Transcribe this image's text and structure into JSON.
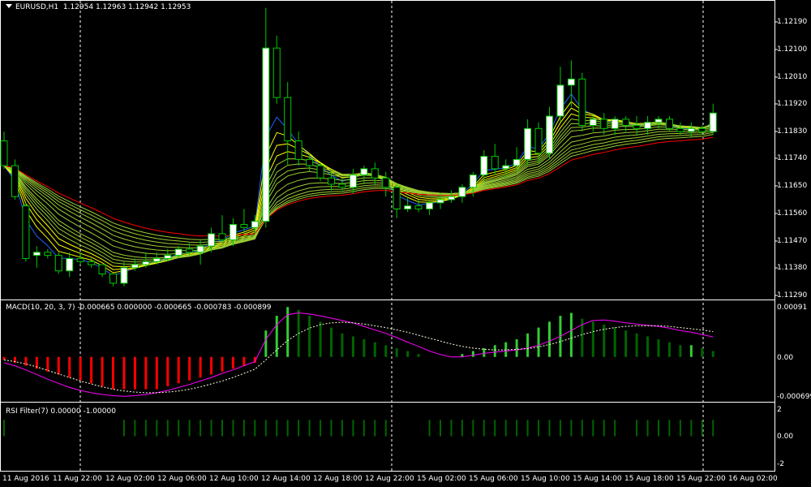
{
  "chart": {
    "symbol": "EURUSD,H1",
    "ohlc": [
      "1.12954",
      "1.12963",
      "1.12942",
      "1.12953"
    ],
    "price_axis": [
      "1.12190",
      "1.12100",
      "1.12010",
      "1.11920",
      "1.11830",
      "1.11740",
      "1.11650",
      "1.11560",
      "1.11470",
      "1.11380",
      "1.11290"
    ]
  },
  "macd": {
    "label": "MACD(10, 20, 3, 7) -0.000665 0.000000 -0.000665 -0.000783 -0.000899",
    "axis": [
      "0.00091",
      "0.00",
      "-0.000699"
    ]
  },
  "rsi": {
    "label": "RSI Filter(7) 0.00000 -1.00000",
    "axis": [
      "2",
      "0.00",
      "-2"
    ]
  },
  "time_axis": [
    "11 Aug 2016",
    "11 Aug 22:00",
    "12 Aug 02:00",
    "12 Aug 06:00",
    "12 Aug 10:00",
    "12 Aug 14:00",
    "12 Aug 18:00",
    "12 Aug 22:00",
    "15 Aug 02:00",
    "15 Aug 06:00",
    "15 Aug 10:00",
    "15 Aug 14:00",
    "15 Aug 18:00",
    "15 Aug 22:00",
    "16 Aug 02:00"
  ],
  "colors": {
    "bull": "#ffffff",
    "bear": "#000000",
    "wick": "#00c800",
    "ribbon_top": "#ffff00",
    "ribbon_low": "#ff0000",
    "ribbon_mid": "#9acd32",
    "blue_ema": "#1e5eff",
    "macd_pos_strong": "#32cd32",
    "macd_pos": "#006400",
    "macd_neg": "#ff0000",
    "macd_line": "#ff00ff",
    "signal_line": "#ffffe0",
    "rsi_bar": "#006400"
  },
  "chart_data": {
    "type": "candlestick",
    "timeframe": "H1",
    "candles": [
      [
        1.1178,
        1.1181,
        1.1169,
        1.117
      ],
      [
        1.117,
        1.1172,
        1.1159,
        1.116
      ],
      [
        1.1157,
        1.1158,
        1.1139,
        1.114
      ],
      [
        1.1141,
        1.1144,
        1.1137,
        1.1142
      ],
      [
        1.1142,
        1.1143,
        1.114,
        1.1141
      ],
      [
        1.1141,
        1.1142,
        1.1135,
        1.1136
      ],
      [
        1.1136,
        1.1142,
        1.1134,
        1.114
      ],
      [
        1.114,
        1.1142,
        1.1138,
        1.1139
      ],
      [
        1.1139,
        1.114,
        1.1137,
        1.1138
      ],
      [
        1.1138,
        1.1138,
        1.1134,
        1.1135
      ],
      [
        1.1135,
        1.1135,
        1.1131,
        1.1132
      ],
      [
        1.1132,
        1.1139,
        1.1131,
        1.1137
      ],
      [
        1.1137,
        1.114,
        1.1136,
        1.1138
      ],
      [
        1.1138,
        1.1142,
        1.1137,
        1.1139
      ],
      [
        1.1139,
        1.1142,
        1.1138,
        1.114
      ],
      [
        1.114,
        1.1143,
        1.1139,
        1.1141
      ],
      [
        1.1141,
        1.1144,
        1.114,
        1.1143
      ],
      [
        1.1143,
        1.1145,
        1.1141,
        1.1142
      ],
      [
        1.1142,
        1.1146,
        1.1138,
        1.1144
      ],
      [
        1.1144,
        1.115,
        1.1142,
        1.1148
      ],
      [
        1.1148,
        1.1154,
        1.1145,
        1.1146
      ],
      [
        1.1146,
        1.1153,
        1.1144,
        1.1151
      ],
      [
        1.1151,
        1.1156,
        1.1148,
        1.115
      ],
      [
        1.115,
        1.1154,
        1.1148,
        1.1152
      ],
      [
        1.1152,
        1.1221,
        1.115,
        1.1208
      ],
      [
        1.1208,
        1.1212,
        1.119,
        1.1192
      ],
      [
        1.1192,
        1.1197,
        1.117,
        1.1178
      ],
      [
        1.1178,
        1.1181,
        1.117,
        1.1172
      ],
      [
        1.1172,
        1.1174,
        1.1168,
        1.117
      ],
      [
        1.117,
        1.1171,
        1.1165,
        1.1166
      ],
      [
        1.1166,
        1.1168,
        1.1162,
        1.1164
      ],
      [
        1.1164,
        1.1166,
        1.1162,
        1.1163
      ],
      [
        1.1163,
        1.1169,
        1.1161,
        1.1167
      ],
      [
        1.1167,
        1.117,
        1.1164,
        1.1169
      ],
      [
        1.1169,
        1.1171,
        1.1164,
        1.1166
      ],
      [
        1.1166,
        1.1168,
        1.116,
        1.1163
      ],
      [
        1.1163,
        1.1164,
        1.1153,
        1.1156
      ],
      [
        1.1156,
        1.116,
        1.1155,
        1.1157
      ],
      [
        1.1157,
        1.1159,
        1.1155,
        1.1156
      ],
      [
        1.1156,
        1.1159,
        1.1154,
        1.1158
      ],
      [
        1.1158,
        1.1161,
        1.1156,
        1.1159
      ],
      [
        1.1159,
        1.1162,
        1.1158,
        1.116
      ],
      [
        1.116,
        1.1164,
        1.1158,
        1.1163
      ],
      [
        1.1163,
        1.1168,
        1.116,
        1.1167
      ],
      [
        1.1167,
        1.1175,
        1.1165,
        1.1173
      ],
      [
        1.1173,
        1.1177,
        1.1167,
        1.1169
      ],
      [
        1.1169,
        1.1172,
        1.1166,
        1.117
      ],
      [
        1.117,
        1.1176,
        1.1168,
        1.1172
      ],
      [
        1.1172,
        1.1185,
        1.117,
        1.1182
      ],
      [
        1.1182,
        1.1184,
        1.1171,
        1.1174
      ],
      [
        1.1174,
        1.1189,
        1.1172,
        1.1186
      ],
      [
        1.1186,
        1.1202,
        1.1184,
        1.1196
      ],
      [
        1.1196,
        1.1204,
        1.1189,
        1.1198
      ],
      [
        1.1198,
        1.12,
        1.1181,
        1.1183
      ],
      [
        1.1183,
        1.1186,
        1.1181,
        1.1185
      ],
      [
        1.1185,
        1.1187,
        1.118,
        1.1182
      ],
      [
        1.1182,
        1.1186,
        1.118,
        1.1185
      ],
      [
        1.1185,
        1.1186,
        1.1181,
        1.1183
      ],
      [
        1.1183,
        1.1186,
        1.118,
        1.1182
      ],
      [
        1.1182,
        1.1186,
        1.118,
        1.1184
      ],
      [
        1.1184,
        1.1186,
        1.1182,
        1.1185
      ],
      [
        1.1185,
        1.1186,
        1.1181,
        1.1182
      ],
      [
        1.1182,
        1.1184,
        1.118,
        1.1181
      ],
      [
        1.1181,
        1.1184,
        1.1179,
        1.1182
      ],
      [
        1.1182,
        1.1183,
        1.118,
        1.1181
      ],
      [
        1.1181,
        1.119,
        1.118,
        1.1187
      ]
    ],
    "ylim": [
      1.1127,
      1.1223
    ],
    "macd": {
      "ylim": [
        -0.00075,
        0.00095
      ],
      "histogram": [
        -5e-05,
        -0.0001,
        -0.00015,
        -0.0002,
        -0.00025,
        -0.0003,
        -0.00035,
        -0.0004,
        -0.00045,
        -0.0005,
        -0.00055,
        -0.00055,
        -0.00055,
        -0.00055,
        -0.00055,
        -0.0005,
        -0.00045,
        -0.0004,
        -0.00035,
        -0.0003,
        -0.00025,
        -0.0002,
        -0.00015,
        -0.0001,
        0.00045,
        0.0007,
        0.00085,
        0.0008,
        0.0007,
        0.0006,
        0.0005,
        0.0004,
        0.00035,
        0.0003,
        0.00025,
        0.0002,
        0.00015,
        0.0001,
        5e-05,
        0.0,
        0.0,
        0.0,
        5e-05,
        0.0001,
        0.00015,
        0.0002,
        0.00025,
        0.0003,
        0.0004,
        0.0005,
        0.0006,
        0.0007,
        0.00075,
        0.00065,
        0.0006,
        0.00055,
        0.0005,
        0.00045,
        0.0004,
        0.00035,
        0.0003,
        0.00025,
        0.0002,
        0.0002,
        0.00015,
        0.0001
      ],
      "macd_line": [
        -0.0001,
        -0.00015,
        -0.00022,
        -0.0003,
        -0.00038,
        -0.00045,
        -0.00052,
        -0.00057,
        -0.00061,
        -0.00064,
        -0.00066,
        -0.00067,
        -0.00066,
        -0.00064,
        -0.00061,
        -0.00057,
        -0.00052,
        -0.00047,
        -0.00041,
        -0.00035,
        -0.00028,
        -0.00022,
        -0.00015,
        -8e-05,
        0.0003,
        0.00055,
        0.00072,
        0.00075,
        0.00073,
        0.0007,
        0.00066,
        0.00062,
        0.00058,
        0.00052,
        0.00046,
        0.0004,
        0.00033,
        0.00025,
        0.00018,
        0.0001,
        4e-05,
        0.0,
        0.0,
        3e-05,
        6e-05,
        8e-05,
        0.0001,
        0.00012,
        0.00015,
        0.0002,
        0.00027,
        0.00035,
        0.00045,
        0.00055,
        0.00062,
        0.00063,
        0.00061,
        0.00058,
        0.00056,
        0.00054,
        0.00052,
        0.00049,
        0.00045,
        0.00042,
        0.00038,
        0.00034
      ],
      "signal_line": [
        -5e-05,
        -8e-05,
        -0.00012,
        -0.00017,
        -0.00023,
        -0.00029,
        -0.00035,
        -0.00041,
        -0.00046,
        -0.00051,
        -0.00055,
        -0.00058,
        -0.0006,
        -0.00061,
        -0.00061,
        -0.0006,
        -0.00058,
        -0.00055,
        -0.00051,
        -0.00046,
        -0.00041,
        -0.00035,
        -0.00028,
        -0.00021,
        -5e-05,
        0.00012,
        0.00028,
        0.0004,
        0.00049,
        0.00055,
        0.00058,
        0.00059,
        0.00058,
        0.00056,
        0.00053,
        0.0005,
        0.00046,
        0.00042,
        0.00037,
        0.00032,
        0.00027,
        0.00022,
        0.00018,
        0.00015,
        0.00013,
        0.00012,
        0.00012,
        0.00013,
        0.00014,
        0.00017,
        0.00021,
        0.00026,
        0.00032,
        0.00038,
        0.00043,
        0.00047,
        0.0005,
        0.00052,
        0.00053,
        0.00053,
        0.00053,
        0.00052,
        0.0005,
        0.00048,
        0.00046,
        0.00043
      ]
    },
    "rsi_filter": {
      "ylim": [
        -2,
        2
      ],
      "values": [
        1,
        0,
        0,
        0,
        0,
        0,
        0,
        0,
        0,
        0,
        0,
        1,
        1,
        1,
        1,
        1,
        1,
        1,
        1,
        1,
        1,
        1,
        1,
        1,
        1,
        1,
        1,
        1,
        1,
        1,
        1,
        1,
        1,
        1,
        1,
        1,
        0,
        0,
        0,
        1,
        1,
        1,
        1,
        1,
        1,
        1,
        1,
        1,
        1,
        1,
        1,
        1,
        1,
        1,
        1,
        1,
        1,
        0,
        1,
        1,
        1,
        1,
        1,
        1,
        1,
        1
      ]
    }
  }
}
